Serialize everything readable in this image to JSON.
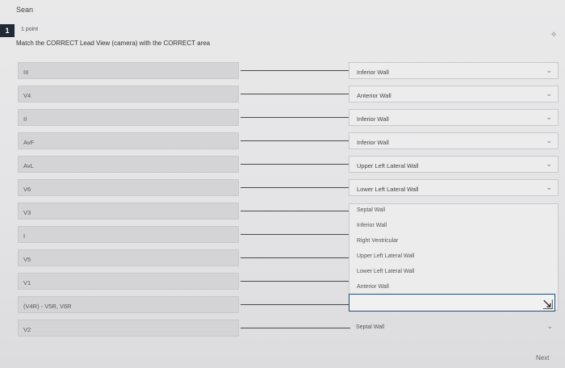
{
  "header": {
    "user_name": "Sean"
  },
  "question": {
    "number": "1",
    "points": "1 point",
    "prompt": "Match the CORRECT Lead View (camera) with the CORRECT area"
  },
  "leads": [
    "III",
    "V4",
    "II",
    "AvF",
    "AvL",
    "V6",
    "V3",
    "I",
    "V5",
    "V1",
    "(V4R) - V5R, V6R",
    "V2"
  ],
  "answers": [
    "Inferior Wall",
    "Anterior Wall",
    "Inferior Wall",
    "Inferior Wall",
    "Upper Left Lateral Wall",
    "Lower Left Lateral Wall"
  ],
  "dropdown_options": [
    "Septal Wall",
    "Inferior Wall",
    "Right Ventricular",
    "Upper Left Lateral Wall",
    "Lower Left Lateral Wall",
    "Anterior Wall"
  ],
  "last_answer": "Septal Wall",
  "icons": {
    "pin": "pin-icon",
    "chevron": "chevron-down-icon",
    "cursor": "mouse-pointer-icon"
  },
  "footer": {
    "next_label": "Next"
  }
}
